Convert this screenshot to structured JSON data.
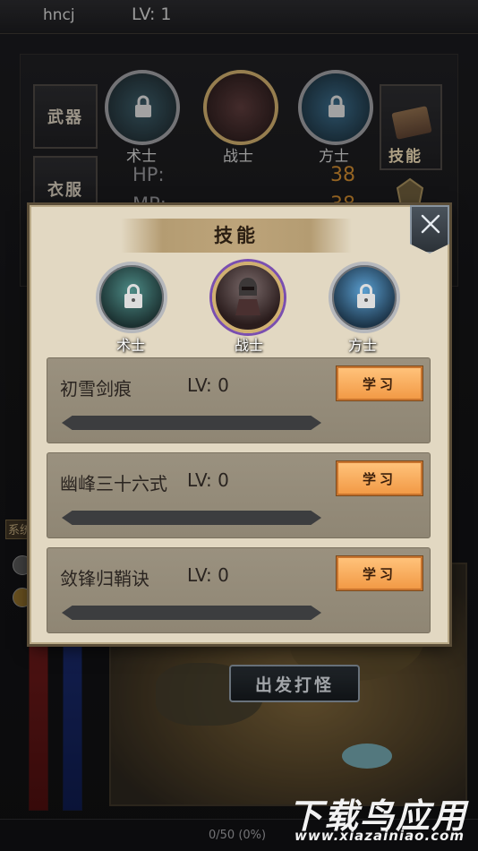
{
  "header": {
    "player_name": "hncj",
    "level": "LV: 1"
  },
  "equipment_tabs": {
    "weapon": "武器",
    "armor": "衣服"
  },
  "background_classes": [
    "术士",
    "战士",
    "方士"
  ],
  "stats": {
    "hp_label": "HP:",
    "hp_value": "38",
    "mp_label": "MP:",
    "mp_value": "38"
  },
  "skill_tab_label": "技能",
  "system_tag": "系统",
  "depart_button": "出发打怪",
  "experience": "0/50  (0%)",
  "watermark": {
    "title": "下载鸟应用",
    "url": "www.xiazainiao.com"
  },
  "dialog": {
    "title": "技能",
    "classes": [
      {
        "name": "术士",
        "locked": true
      },
      {
        "name": "战士",
        "locked": false,
        "selected": true
      },
      {
        "name": "方士",
        "locked": true
      }
    ],
    "skills": [
      {
        "name": "初雪剑痕",
        "level": "LV: 0",
        "button": "学习",
        "progress": 0
      },
      {
        "name": "幽峰三十六式",
        "level": "LV: 0",
        "button": "学习",
        "progress": 0
      },
      {
        "name": "敛锋归鞘诀",
        "level": "LV: 0",
        "button": "学习",
        "progress": 0
      }
    ]
  },
  "colors": {
    "accent": "#f29a46",
    "panel": "#e2d8c2",
    "row": "#948b79",
    "hp": "#c7862e"
  }
}
